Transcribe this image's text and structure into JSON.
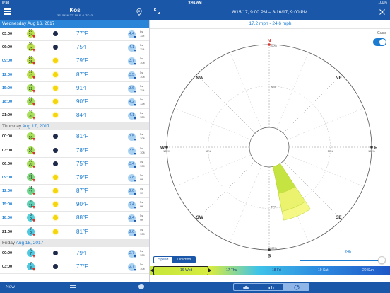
{
  "status": {
    "device": "iPad",
    "time": "9:41 AM",
    "battery": "100%"
  },
  "header": {
    "location": "Kos",
    "coords": "36° 54' N 27° 18' E · UTC+3",
    "range": "8/15/17, 9:00 PM – 8/16/17, 9:00 PM"
  },
  "rose": {
    "speed_range": "17.2 mph - 24.6 mph",
    "gusts_label": "Gusts",
    "gusts_on": true,
    "compass": {
      "N": "N",
      "NE": "NE",
      "E": "E",
      "SE": "SE",
      "S": "S",
      "SW": "SW",
      "W": "W",
      "NW": "NW"
    },
    "pct_labels": {
      "p100": "100%",
      "p50": "50%"
    },
    "sectors": [
      {
        "direction_deg": 157.5,
        "value_pct": 0.33,
        "color": "#c0e03a"
      },
      {
        "direction_deg": 157.5,
        "value_pct": 0.55,
        "color": "#e9f26a"
      },
      {
        "direction_deg": 157.5,
        "value_pct": 0.66,
        "color": "#f3f770"
      }
    ],
    "mode_tabs": [
      "Speed",
      "Direction"
    ],
    "active_mode": "Direction",
    "slider_label": "24h",
    "timeline": [
      "16 Wed",
      "17 Thu",
      "18 Fri",
      "19 Sat",
      "20 Sun"
    ]
  },
  "days": [
    {
      "dow": "Wednesday",
      "date": "Aug 16, 2017",
      "first": true,
      "rows": [
        {
          "time": "03:00",
          "daylight": false,
          "wind": "20",
          "windu": "24",
          "wcol": "#b9e04a",
          "cond": "moon",
          "temp": "77°F",
          "wave": "4.4",
          "per": "6s",
          "dir": "11ft"
        },
        {
          "time": "06:00",
          "daylight": false,
          "wind": "20",
          "windu": "25",
          "wcol": "#b9e04a",
          "cond": "moon",
          "temp": "75°F",
          "wave": "4.1",
          "per": "5s",
          "dir": "11ft"
        },
        {
          "time": "09:00",
          "daylight": true,
          "wind": "20",
          "windu": "25",
          "wcol": "#b9e04a",
          "cond": "sun",
          "temp": "79°F",
          "wave": "3.7",
          "per": "5s",
          "dir": "10ft"
        },
        {
          "time": "12:00",
          "daylight": true,
          "wind": "19",
          "windu": "23",
          "wcol": "#b9e04a",
          "cond": "sun",
          "temp": "87°F",
          "wave": "3.5",
          "per": "5s",
          "dir": "10ft"
        },
        {
          "time": "15:00",
          "daylight": true,
          "wind": "18",
          "windu": "22",
          "wcol": "#a6e05a",
          "cond": "sun",
          "temp": "91°F",
          "wave": "3.6",
          "per": "5s",
          "dir": "11ft"
        },
        {
          "time": "18:00",
          "daylight": true,
          "wind": "17",
          "windu": "20",
          "wcol": "#a6e05a",
          "cond": "sun",
          "temp": "90°F",
          "wave": "4.2",
          "per": "5s",
          "dir": "12ft"
        },
        {
          "time": "21:00",
          "daylight": false,
          "wind": "17",
          "windu": "20",
          "wcol": "#a6e05a",
          "cond": "sun",
          "temp": "84°F",
          "wave": "4.1",
          "per": "5s",
          "dir": "12ft"
        }
      ]
    },
    {
      "dow": "Thursday",
      "date": "Aug 17, 2017",
      "first": false,
      "rows": [
        {
          "time": "00:00",
          "daylight": false,
          "wind": "17",
          "windu": "20",
          "wcol": "#a6e05a",
          "cond": "moon",
          "temp": "81°F",
          "wave": "3.5",
          "per": "5s",
          "dir": "10ft"
        },
        {
          "time": "03:00",
          "daylight": false,
          "wind": "17",
          "windu": "20",
          "wcol": "#a6e05a",
          "cond": "moon",
          "temp": "78°F",
          "wave": "3.5",
          "per": "5s",
          "dir": "10ft"
        },
        {
          "time": "06:00",
          "daylight": false,
          "wind": "17",
          "windu": "20",
          "wcol": "#a6e05a",
          "cond": "moon",
          "temp": "75°F",
          "wave": "3.4",
          "per": "5s",
          "dir": "10ft"
        },
        {
          "time": "09:00",
          "daylight": true,
          "wind": "15",
          "windu": "18",
          "wcol": "#7fd87a",
          "cond": "sun",
          "temp": "79°F",
          "wave": "2.8",
          "per": "5s",
          "dir": "9ft"
        },
        {
          "time": "12:00",
          "daylight": true,
          "wind": "11",
          "windu": "13",
          "wcol": "#6fd68e",
          "cond": "sun",
          "temp": "87°F",
          "wave": "2.6",
          "per": "5s",
          "dir": "9ft"
        },
        {
          "time": "15:00",
          "daylight": true,
          "wind": "10",
          "windu": "12",
          "wcol": "#5fd0b6",
          "cond": "sun",
          "temp": "90°F",
          "wave": "2.4",
          "per": "5s",
          "dir": "9ft"
        },
        {
          "time": "18:00",
          "daylight": true,
          "wind": "8",
          "windu": "9",
          "wcol": "#55cfd8",
          "cond": "sun",
          "temp": "88°F",
          "wave": "2.4",
          "per": "5s",
          "dir": "9ft"
        },
        {
          "time": "21:00",
          "daylight": false,
          "wind": "7",
          "windu": "8",
          "wcol": "#4fc8e0",
          "cond": "sun",
          "temp": "81°F",
          "wave": "2.6",
          "per": "5s",
          "dir": "10ft"
        }
      ]
    },
    {
      "dow": "Friday",
      "date": "Aug 18, 2017",
      "first": false,
      "rows": [
        {
          "time": "00:00",
          "daylight": false,
          "wind": "6",
          "windu": "7",
          "wcol": "#4fc8e0",
          "cond": "moon",
          "temp": "79°F",
          "wave": "2.7",
          "per": "5s",
          "dir": "10ft"
        },
        {
          "time": "03:00",
          "daylight": false,
          "wind": "7",
          "windu": "8",
          "wcol": "#4fc8e0",
          "cond": "moon",
          "temp": "77°F",
          "wave": "2.7",
          "per": "5s",
          "dir": "10ft"
        }
      ]
    }
  ],
  "bottom": {
    "now_label": "Now"
  }
}
